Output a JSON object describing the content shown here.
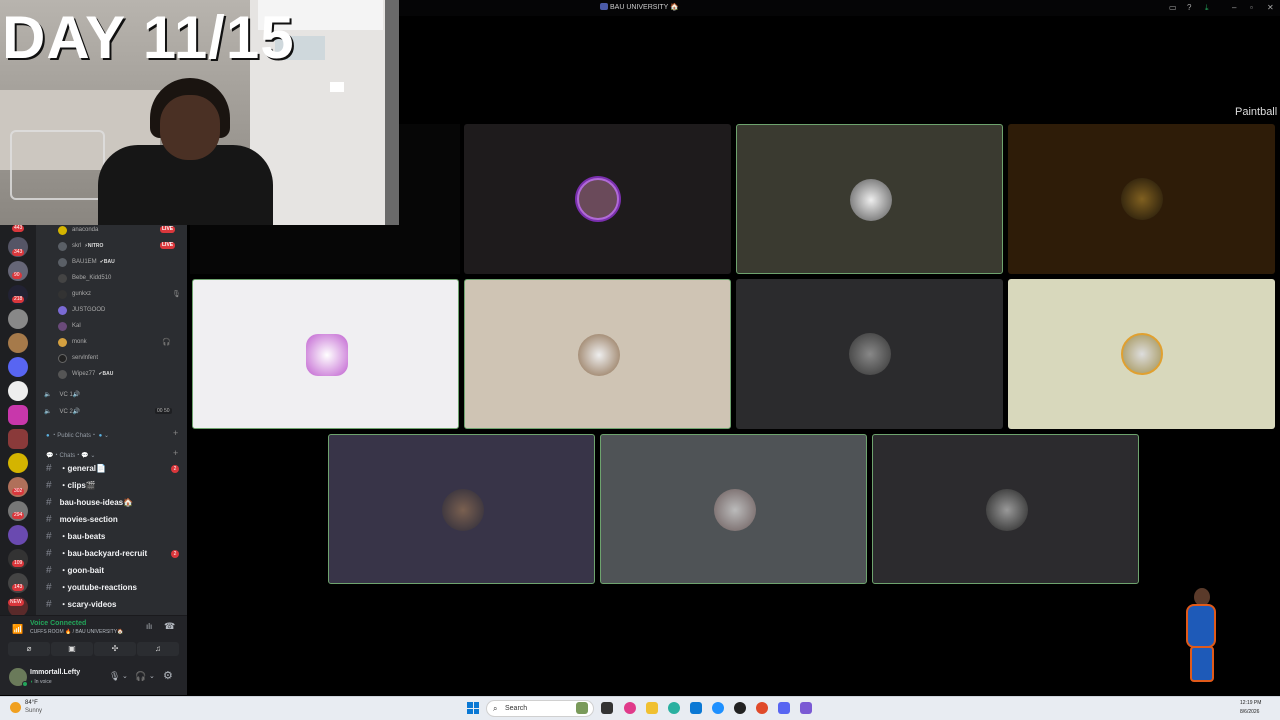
{
  "window": {
    "title": "BAU UNIVERSITY 🏠",
    "title_icon": "server-icon"
  },
  "overlay": {
    "day_text": "DAY 11/15"
  },
  "servers": {
    "badges": [
      "443",
      "343",
      "218",
      "90",
      "302",
      "294",
      "109",
      "143",
      "NEW"
    ]
  },
  "members": [
    {
      "name": "anaconda",
      "live": "LIVE",
      "color": "#d4b400",
      "tag": ""
    },
    {
      "name": "skrl",
      "live": "LIVE",
      "color": "#5a5f66",
      "tag": "⚡NITRO"
    },
    {
      "name": "BAU1EM",
      "live": "",
      "color": "#5a5f66",
      "tag": "✔BAU"
    },
    {
      "name": "Bebe_Kidd510",
      "live": "",
      "color": "#444",
      "tag": ""
    },
    {
      "name": "gunkxz",
      "live": "",
      "color": "#333",
      "tag": ""
    },
    {
      "name": "JUSTGOOD",
      "live": "",
      "color": "#7a6ad4",
      "tag": ""
    },
    {
      "name": "Kal",
      "live": "",
      "color": "#6a4a7a",
      "tag": ""
    },
    {
      "name": "monk",
      "live": "",
      "color": "#d4a040",
      "tag": ""
    },
    {
      "name": "servlnfent",
      "live": "",
      "color": "#222",
      "tag": ""
    },
    {
      "name": "Wipez77",
      "live": "",
      "color": "#555",
      "tag": "✔BAU"
    }
  ],
  "voice_channels": [
    {
      "name": "VC 1🔊",
      "count": ""
    },
    {
      "name": "VC 2🔊",
      "count": "00 50"
    }
  ],
  "categories": {
    "public": "Public Chats",
    "chats": "Chats"
  },
  "channels": [
    {
      "name": "・general📄",
      "badge": "2"
    },
    {
      "name": "・clips🎬",
      "badge": ""
    },
    {
      "name": "bau-house-ideas🏠",
      "badge": ""
    },
    {
      "name": "movies-section",
      "badge": ""
    },
    {
      "name": "・bau-beats",
      "badge": ""
    },
    {
      "name": "・bau-backyard-recruit",
      "badge": "2"
    },
    {
      "name": "・goon-bait",
      "badge": ""
    },
    {
      "name": "・youtube-reactions",
      "badge": ""
    },
    {
      "name": "・scary-videos",
      "badge": ""
    }
  ],
  "voice": {
    "status": "Voice Connected",
    "location": "CUFFS ROOM 🔥 / BAU UNIVERSITY🏠"
  },
  "user": {
    "name": "Immortall.Lefty",
    "status": "In voice"
  },
  "activity": {
    "label": "Paintball"
  },
  "tiles": [
    {
      "bg": "#1e1b1c",
      "av": "#b06ad6",
      "speaking": false
    },
    {
      "bg": "#3a3a30",
      "av": "#ddd",
      "speaking": true
    },
    {
      "bg": "#2e1c08",
      "av": "#806020",
      "speaking": false
    },
    {
      "bg": "#f0eff2",
      "av": "#c060d0",
      "speaking": true
    },
    {
      "bg": "#cfc4b4",
      "av": "#8a6a4a",
      "speaking": true
    },
    {
      "bg": "#2b2b2d",
      "av": "#666",
      "speaking": false
    },
    {
      "bg": "#d8d8bc",
      "av": "#a09050",
      "speaking": false
    },
    {
      "bg": "#383448",
      "av": "#4a4a5a",
      "speaking": true
    },
    {
      "bg": "#4f5356",
      "av": "#8a8a8a",
      "speaking": true
    },
    {
      "bg": "#2c2b2e",
      "av": "#555",
      "speaking": true
    }
  ],
  "taskbar": {
    "weather_temp": "84°F",
    "weather_desc": "Sunny",
    "search_placeholder": "Search",
    "time": "12:19 PM",
    "date": "8/6/2026"
  },
  "colors": {
    "accent": "#5865f2",
    "speaking": "#6ea36e",
    "live": "#da373c",
    "voice_connected": "#23a55a"
  }
}
